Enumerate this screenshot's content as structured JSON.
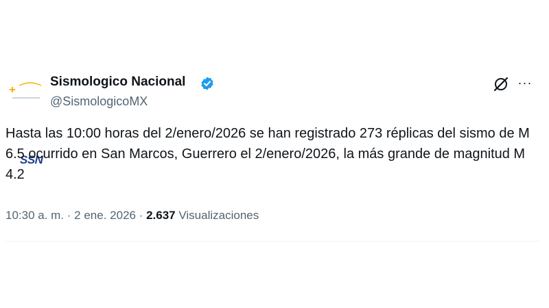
{
  "author": {
    "display_name": "Sismologico Nacional",
    "handle": "@SismologicoMX",
    "avatar_text": "SSN",
    "verified_icon": "verified-badge-icon"
  },
  "actions": {
    "grok_icon": "grok-icon",
    "more_label": "···"
  },
  "post": {
    "text": "Hasta las 10:00 horas del 2/enero/2026 se han registrado 273 réplicas del sismo de M 6.5 ocurrido en San Marcos, Guerrero el 2/enero/2026, la más grande de magnitud M 4.2"
  },
  "meta": {
    "time": "10:30 a. m.",
    "separator": " · ",
    "date": "2 ene. 2026",
    "views_count": "2.637",
    "views_label": "Visualizaciones"
  },
  "colors": {
    "verified": "#1d9bf0",
    "text": "#0f1419",
    "secondary": "#536471",
    "logo": "#1b3f8b",
    "logo_accent": "#f5b400"
  }
}
